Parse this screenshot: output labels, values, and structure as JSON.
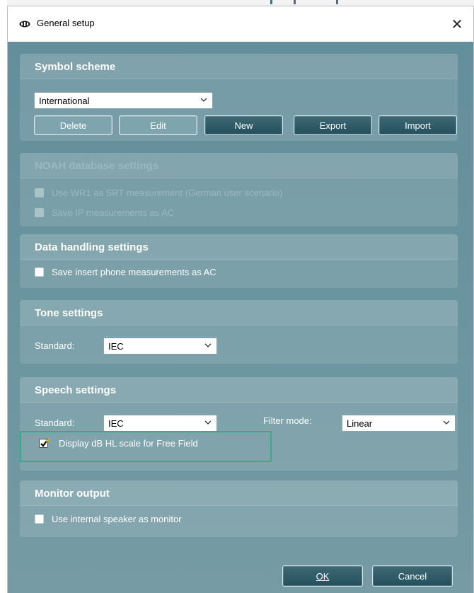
{
  "window": {
    "title": "General setup",
    "close_glyph": "✕"
  },
  "symbol_scheme": {
    "title": "Symbol scheme",
    "selected": "International",
    "buttons": {
      "delete": "Delete",
      "edit": "Edit",
      "new": "New",
      "export": "Export",
      "import": "Import"
    }
  },
  "noah": {
    "title": "NOAH database settings",
    "options": [
      {
        "label": "Use WR1 as SRT measurement (German user scenario)",
        "checked": false,
        "enabled": false
      },
      {
        "label": "Save IP measurements as AC",
        "checked": false,
        "enabled": false
      }
    ]
  },
  "data_handling": {
    "title": "Data handling settings",
    "option": {
      "label": "Save insert phone measurements as AC",
      "checked": false
    }
  },
  "tone": {
    "title": "Tone settings",
    "standard_label": "Standard:",
    "standard_value": "IEC"
  },
  "speech": {
    "title": "Speech settings",
    "standard_label": "Standard:",
    "standard_value": "IEC",
    "filter_label": "Filter mode:",
    "filter_value": "Linear",
    "option": {
      "label": "Display dB HL scale for Free Field",
      "checked": true
    }
  },
  "monitor": {
    "title": "Monitor output",
    "option": {
      "label": "Use internal speaker as monitor",
      "checked": false
    }
  },
  "footer": {
    "ok": "OK",
    "cancel": "Cancel"
  },
  "colors": {
    "accent_highlight": "#2eaf84",
    "panel": "#6b959f",
    "dark_button": "#24505d"
  }
}
